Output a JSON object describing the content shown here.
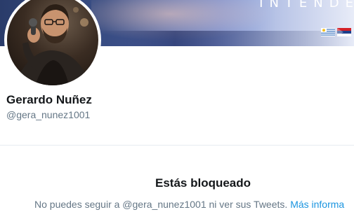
{
  "banner": {
    "partial_text": "INTENDE",
    "flags": [
      {
        "name": "uruguay-flag-icon",
        "colors": [
          "#ffffff",
          "#4a7fc4",
          "#f4c020"
        ]
      },
      {
        "name": "frente-amplio-flag-icon",
        "colors": [
          "#d32027",
          "#1e3f8c",
          "#ffffff"
        ]
      }
    ]
  },
  "profile": {
    "display_name": "Gerardo Nuñez",
    "handle": "@gera_nunez1001"
  },
  "blocked": {
    "title": "Estás bloqueado",
    "message": "No puedes seguir a @gera_nunez1001 ni ver sus Tweets. ",
    "link_label": "Más informa"
  },
  "colors": {
    "text_primary": "#14171a",
    "text_secondary": "#657786",
    "link": "#1b95e0",
    "divider": "#e6ecf0"
  }
}
